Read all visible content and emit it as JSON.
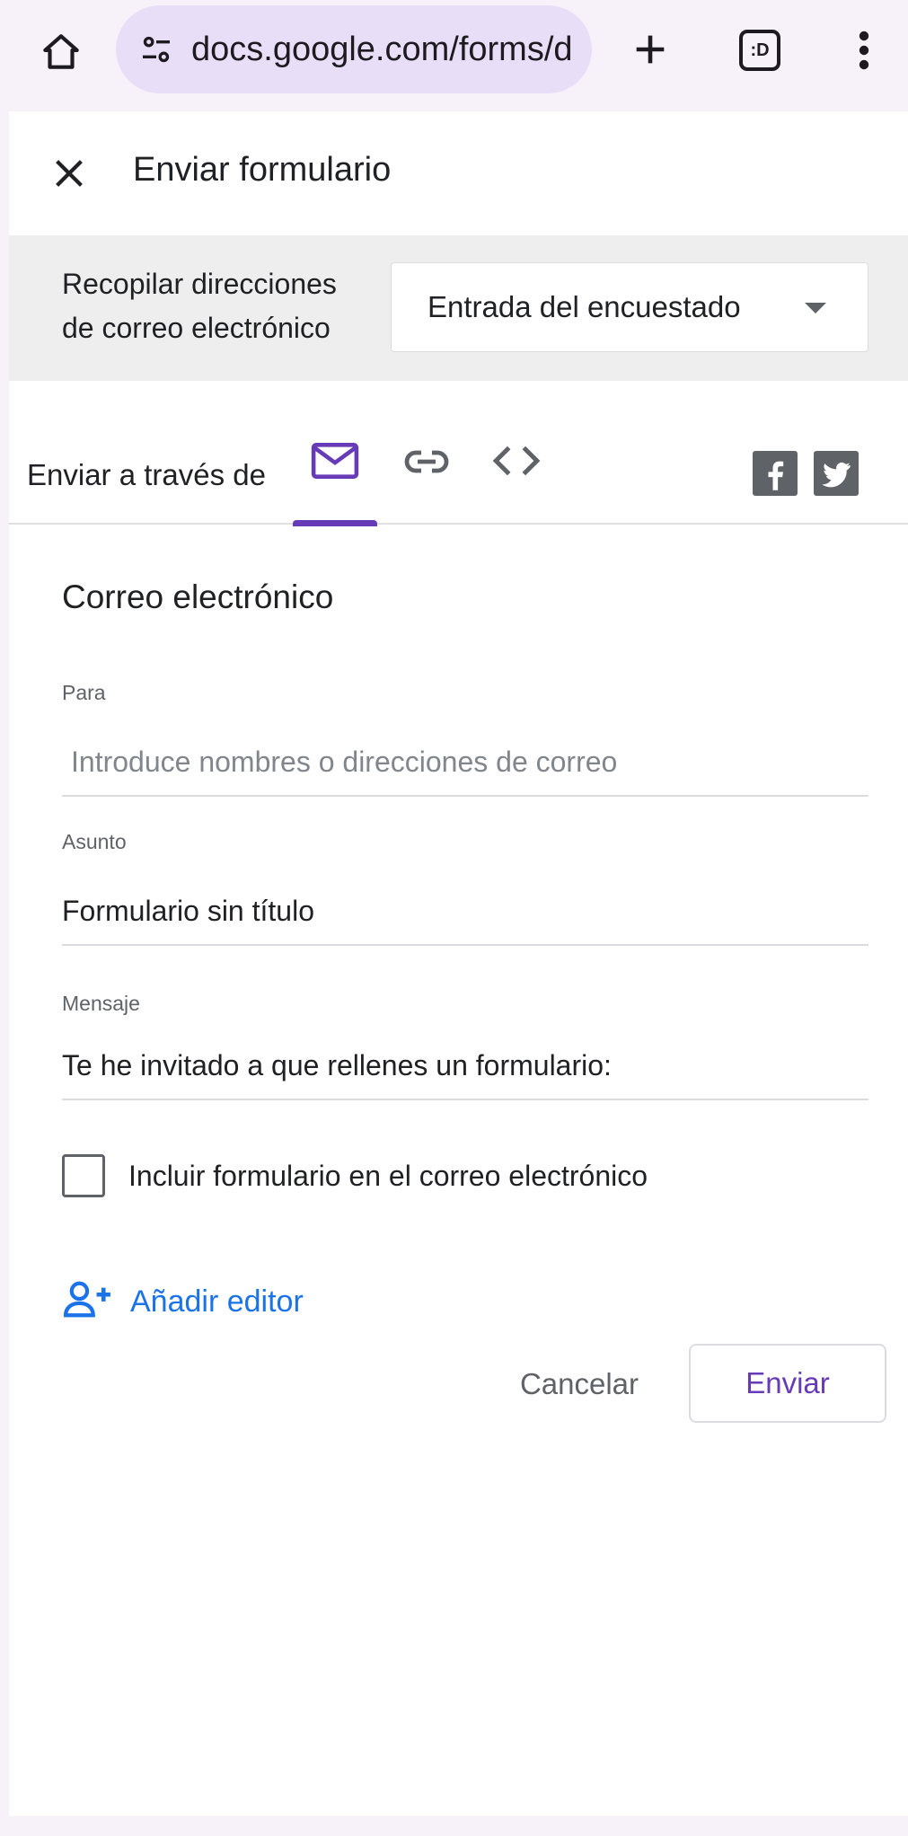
{
  "browser": {
    "url": "docs.google.com/forms/d",
    "icons": [
      "home-icon",
      "site-info-icon",
      "new-tab-icon",
      "tab-switcher-icon",
      "more-menu-icon"
    ],
    "tab_switcher_label": ":D"
  },
  "dialog": {
    "title": "Enviar formulario",
    "collect_emails": {
      "label": "Recopilar direcciones de correo electrónico",
      "selected": "Entrada del encuestado"
    },
    "send_via": {
      "label": "Enviar a través de",
      "tabs": [
        "email-icon",
        "link-icon",
        "embed-icon"
      ],
      "active_tab": "email-icon",
      "share_icons": [
        "facebook-icon",
        "twitter-icon"
      ]
    },
    "email": {
      "section_title": "Correo electrónico",
      "to_label": "Para",
      "to_placeholder": "Introduce nombres o direcciones de correo",
      "subject_label": "Asunto",
      "subject_value": "Formulario sin título",
      "message_label": "Mensaje",
      "message_value": "Te he invitado a que rellenes un formulario:",
      "include_form_label": "Incluir formulario en el correo electrónico",
      "include_form_checked": false,
      "add_editor_label": "Añadir editor"
    },
    "buttons": {
      "cancel": "Cancelar",
      "send": "Enviar"
    },
    "colors": {
      "accent": "#673ab7",
      "link": "#1a73e8"
    }
  }
}
